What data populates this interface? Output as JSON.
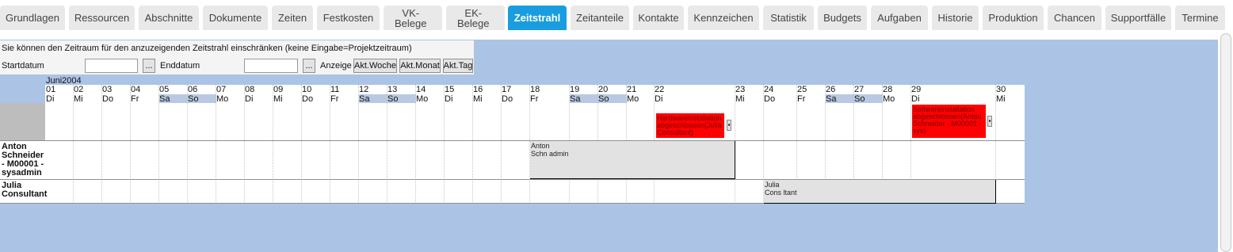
{
  "tabs": [
    {
      "label": "Grundlagen",
      "active": false
    },
    {
      "label": "Ressourcen",
      "active": false
    },
    {
      "label": "Abschnitte",
      "active": false
    },
    {
      "label": "Dokumente",
      "active": false
    },
    {
      "label": "Zeiten",
      "active": false
    },
    {
      "label": "Festkosten",
      "active": false
    },
    {
      "label": "VK-\nBelege",
      "active": false
    },
    {
      "label": "EK-\nBelege",
      "active": false
    },
    {
      "label": "Zeitstrahl",
      "active": true
    },
    {
      "label": "Zeitanteile",
      "active": false
    },
    {
      "label": "Kontakte",
      "active": false
    },
    {
      "label": "Kennzeichen",
      "active": false
    },
    {
      "label": "Statistik",
      "active": false
    },
    {
      "label": "Budgets",
      "active": false
    },
    {
      "label": "Aufgaben",
      "active": false
    },
    {
      "label": "Historie",
      "active": false
    },
    {
      "label": "Produktion",
      "active": false
    },
    {
      "label": "Chancen",
      "active": false
    },
    {
      "label": "Supportfälle",
      "active": false
    },
    {
      "label": "Termine",
      "active": false
    }
  ],
  "filter": {
    "info": "Sie können den Zeitraum für den anzuzeigenden Zeitstrahl einschränken (keine Eingabe=Projektzeitraum)",
    "start_label": "Startdatum",
    "start_value": "",
    "start_picker": "...",
    "end_label": "Enddatum",
    "end_value": "",
    "end_picker": "...",
    "anzeige_label": "Anzeige",
    "btn_week": "Akt.Woche",
    "btn_month": "Akt.Monat",
    "btn_day": "Akt.Tag"
  },
  "timeline": {
    "month": "Juni2004",
    "days": [
      {
        "num": "01",
        "name": "Di"
      },
      {
        "num": "02",
        "name": "Mi"
      },
      {
        "num": "03",
        "name": "Do"
      },
      {
        "num": "04",
        "name": "Fr"
      },
      {
        "num": "05",
        "name": "Sa"
      },
      {
        "num": "06",
        "name": "So"
      },
      {
        "num": "07",
        "name": "Mo"
      },
      {
        "num": "08",
        "name": "Di"
      },
      {
        "num": "09",
        "name": "Mi"
      },
      {
        "num": "10",
        "name": "Do"
      },
      {
        "num": "11",
        "name": "Fr"
      },
      {
        "num": "12",
        "name": "Sa"
      },
      {
        "num": "13",
        "name": "So"
      },
      {
        "num": "14",
        "name": "Mo"
      },
      {
        "num": "15",
        "name": "Di"
      },
      {
        "num": "16",
        "name": "Mi"
      },
      {
        "num": "17",
        "name": "Do"
      },
      {
        "num": "18",
        "name": "Fr"
      },
      {
        "num": "19",
        "name": "Sa"
      },
      {
        "num": "20",
        "name": "So"
      },
      {
        "num": "21",
        "name": "Mo"
      },
      {
        "num": "22",
        "name": "Di"
      },
      {
        "num": "23",
        "name": "Mi"
      },
      {
        "num": "24",
        "name": "Do"
      },
      {
        "num": "25",
        "name": "Fr"
      },
      {
        "num": "26",
        "name": "Sa"
      },
      {
        "num": "27",
        "name": "So"
      },
      {
        "num": "28",
        "name": "Mo"
      },
      {
        "num": "29",
        "name": "Di"
      },
      {
        "num": "30",
        "name": "Mi"
      }
    ],
    "milestones": [
      {
        "text": "Hardwareinstallation abgeschlossen(Julia Consultant)",
        "button": "▪"
      },
      {
        "text": "Softwareinstallation abgeschlossen(Anton Schneider - M00001 - sys)",
        "button": "▪"
      }
    ],
    "resources": [
      {
        "name": "Anton\nSchneider\n- M00001 -\nsysadmin",
        "bar_label": "Anton\nSchn admin"
      },
      {
        "name": "Julia\nConsultant",
        "bar_label": "Julia\nCons ltant"
      }
    ]
  },
  "colors": {
    "active_tab": "#1a9de0",
    "background": "#abc3e4",
    "milestone": "#ff0000",
    "bar": "#e2e2e2"
  }
}
